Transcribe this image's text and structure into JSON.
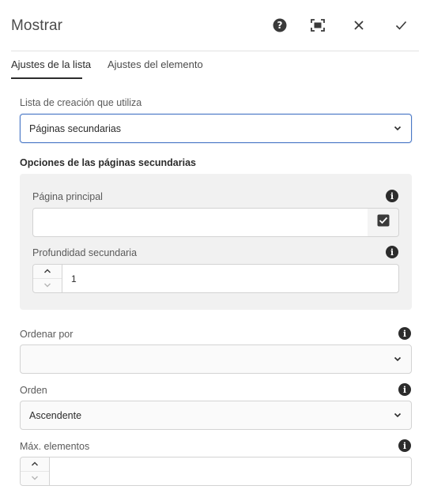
{
  "header": {
    "title": "Mostrar",
    "icons": [
      "help-icon",
      "fullscreen-icon",
      "close-icon",
      "checkmark-icon"
    ]
  },
  "tabs": [
    {
      "label": "Ajustes de la lista",
      "active": true
    },
    {
      "label": "Ajustes del elemento",
      "active": false
    }
  ],
  "list_source": {
    "label": "Lista de creación que utiliza",
    "value": "Páginas secundarias"
  },
  "children_options": {
    "title": "Opciones de las páginas secundarias",
    "parent_page": {
      "label": "Página principal",
      "value": ""
    },
    "child_depth": {
      "label": "Profundidad secundaria",
      "value": "1"
    }
  },
  "order_by": {
    "label": "Ordenar por",
    "value": ""
  },
  "sort_order": {
    "label": "Orden",
    "value": "Ascendente"
  },
  "max_items": {
    "label": "Máx. elementos",
    "value": ""
  },
  "colors": {
    "accent_focus": "#4a78c6",
    "text_dark": "#2c2c2c",
    "group_bg": "#f1f1f1"
  }
}
